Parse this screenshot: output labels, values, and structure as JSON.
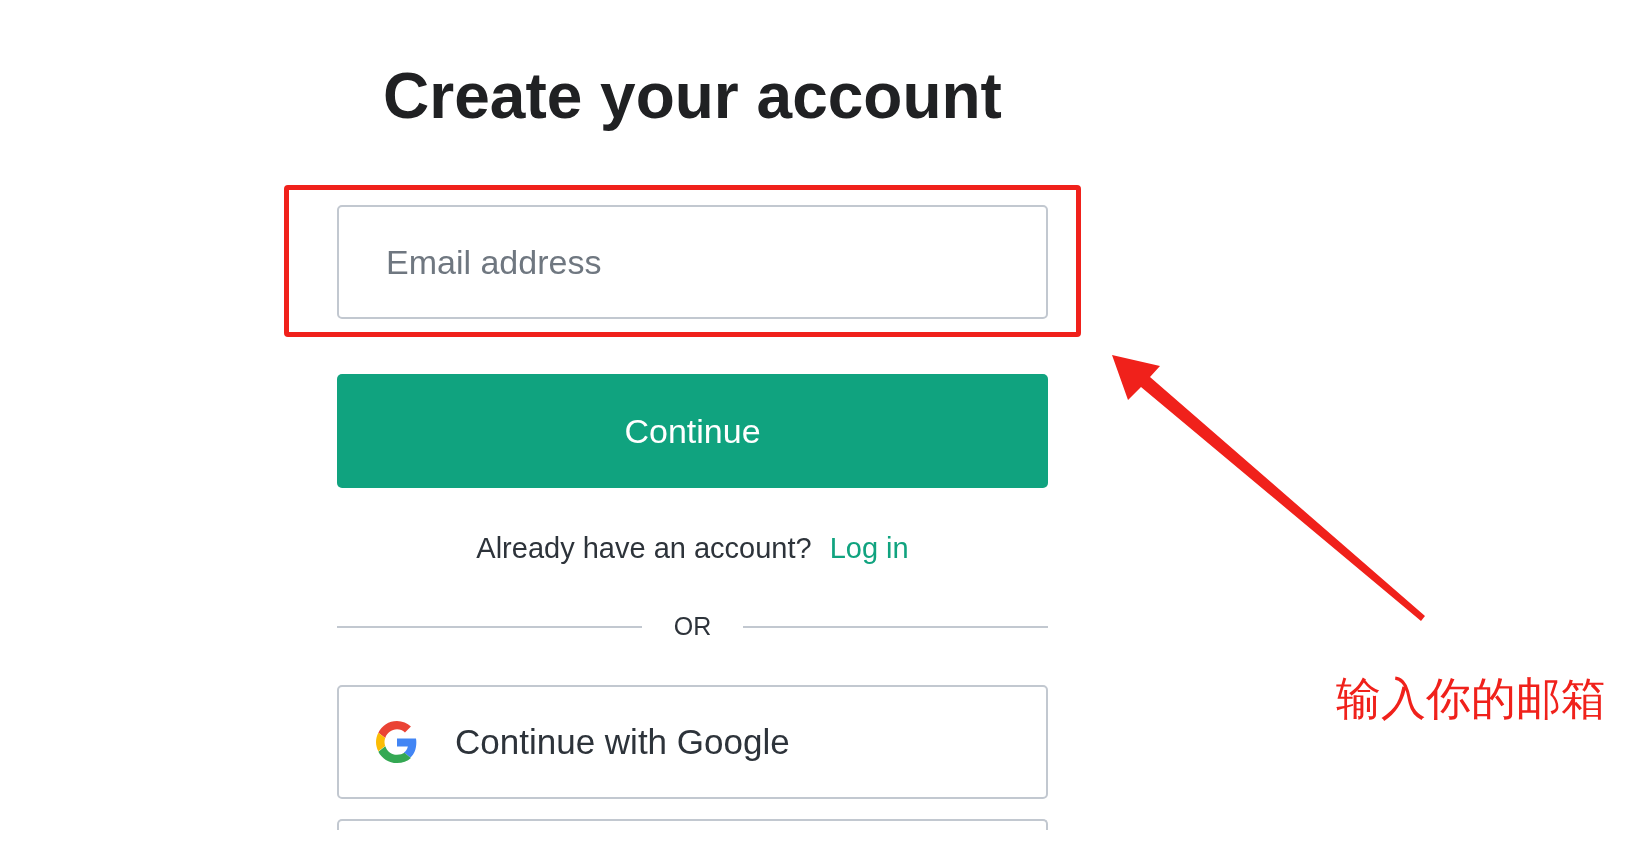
{
  "title": "Create your account",
  "email_field": {
    "placeholder": "Email address"
  },
  "continue_button": {
    "label": "Continue"
  },
  "login_prompt": {
    "text": "Already have an account?",
    "link": "Log in"
  },
  "divider": {
    "label": "OR"
  },
  "social_buttons": [
    {
      "kind": "google",
      "label": "Continue with Google"
    },
    {
      "kind": "partial"
    }
  ],
  "annotation": {
    "text": "输入你的邮箱"
  }
}
